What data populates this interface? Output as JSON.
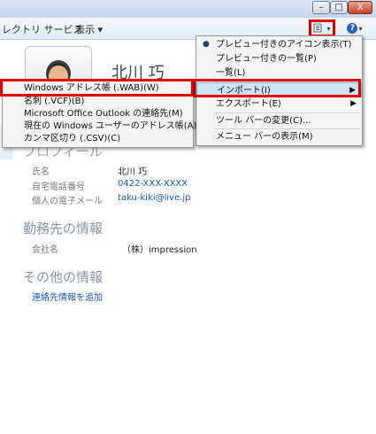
{
  "window": {
    "minimize": "–",
    "maximize": "□",
    "close": "X"
  },
  "toolbar": {
    "directory": "レクトリ サービス",
    "view": "表示 ▾",
    "views_button": "▾",
    "help_button": "? ▾"
  },
  "contact": {
    "name": "北川 巧",
    "profile_section": "プロフィール",
    "fields": [
      {
        "label": "氏名",
        "value": "北川 巧",
        "link": false
      },
      {
        "label": "自宅電話番号",
        "value": "0422-XXX-XXXX",
        "link": true
      },
      {
        "label": "個人の電子メール",
        "value": "taku-kiki@live.jp",
        "link": true
      }
    ],
    "work_section": "勤務先の情報",
    "work_fields": [
      {
        "label": "会社名",
        "value": "（株）impression"
      }
    ],
    "other_section": "その他の情報",
    "add_link": "連絡先情報を追加"
  },
  "main_menu": {
    "items": [
      {
        "label": "プレビュー付きのアイコン表示(T)",
        "selected": true
      },
      {
        "label": "プレビュー付きの一覧(P)"
      },
      {
        "label": "一覧(L)"
      },
      {
        "label": "インポート(I)",
        "submenu": true,
        "highlighted": true
      },
      {
        "label": "エクスポート(E)",
        "submenu": true
      },
      {
        "label": "ツール バーの変更(C)..."
      },
      {
        "label": "メニュー バーの表示(M)"
      }
    ],
    "bullet": "●",
    "arrow": "▶"
  },
  "import_submenu": {
    "items": [
      {
        "label": "Windows アドレス帳 (.WAB)(W)",
        "highlighted": true
      },
      {
        "label": "名刺 (.VCF)(B)"
      },
      {
        "label": "Microsoft Office Outlook の連絡先(M)"
      },
      {
        "label": "現在の Windows ユーザーのアドレス帳(A)"
      },
      {
        "label": "カンマ区切り (.CSV)(C)"
      }
    ]
  }
}
